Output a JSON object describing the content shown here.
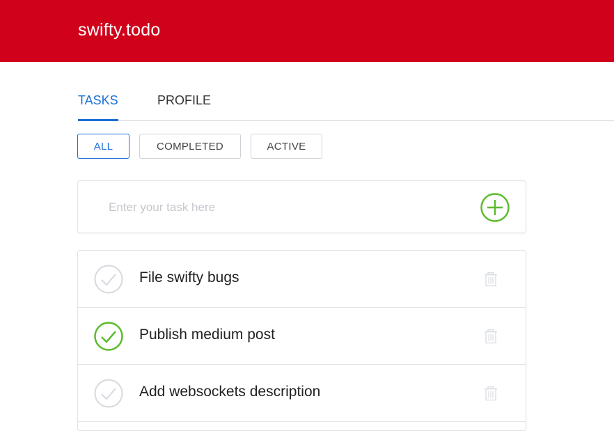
{
  "app": {
    "brand": "swifty.todo",
    "accent_color": "#d0021b"
  },
  "tabs": [
    {
      "label": "TASKS",
      "active": true
    },
    {
      "label": "PROFILE",
      "active": false
    }
  ],
  "filters": [
    {
      "label": "ALL",
      "active": true
    },
    {
      "label": "COMPLETED",
      "active": false
    },
    {
      "label": "ACTIVE",
      "active": false
    }
  ],
  "new_task": {
    "placeholder": "Enter your task here",
    "value": "",
    "add_icon": "plus-circle-icon"
  },
  "tasks": [
    {
      "title": "File swifty bugs",
      "completed": false
    },
    {
      "title": "Publish medium post",
      "completed": true
    },
    {
      "title": "Add websockets description",
      "completed": false
    }
  ],
  "colors": {
    "primary_blue": "#1a6fd9",
    "success_green": "#5dbb2e",
    "muted_gray": "#d6d9dd"
  }
}
